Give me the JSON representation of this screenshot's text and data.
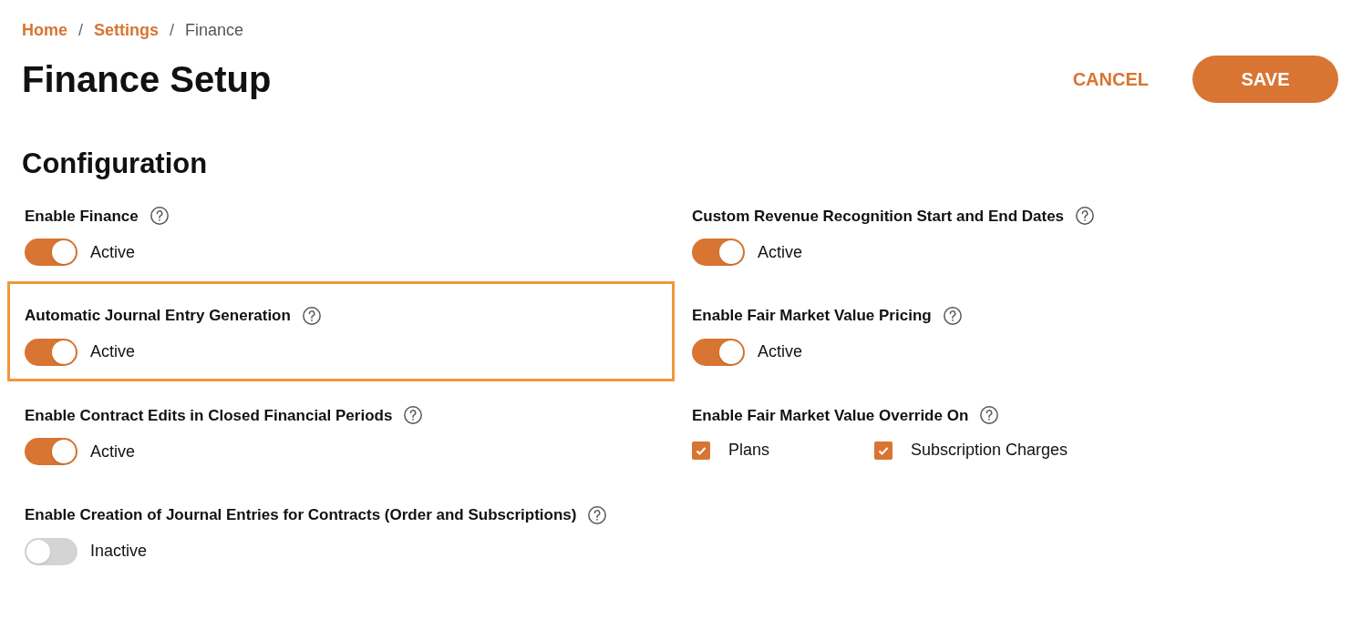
{
  "breadcrumb": [
    {
      "kind": "link",
      "label": "Home"
    },
    {
      "kind": "separator",
      "label": "/"
    },
    {
      "kind": "link",
      "label": "Settings"
    },
    {
      "kind": "separator",
      "label": "/"
    },
    {
      "kind": "current",
      "label": "Finance"
    }
  ],
  "title": "Finance Setup",
  "actions": {
    "cancel": "CANCEL",
    "save": "SAVE"
  },
  "section_title": "Configuration",
  "settings": [
    {
      "kind": "toggle",
      "label": "Enable Finance",
      "on": true,
      "status": "Active",
      "highlighted": false
    },
    {
      "kind": "toggle",
      "label": "Custom Revenue Recognition Start and End Dates",
      "on": true,
      "status": "Active",
      "highlighted": false
    },
    {
      "kind": "toggle",
      "label": "Automatic Journal Entry Generation",
      "on": true,
      "status": "Active",
      "highlighted": true
    },
    {
      "kind": "toggle",
      "label": "Enable Fair Market Value Pricing",
      "on": true,
      "status": "Active",
      "highlighted": false
    },
    {
      "kind": "toggle",
      "label": "Enable Contract Edits in Closed Financial Periods",
      "on": true,
      "status": "Active",
      "highlighted": false
    },
    {
      "kind": "checkboxes",
      "label": "Enable Fair Market Value Override On",
      "highlighted": false,
      "options": [
        {
          "label": "Plans",
          "checked": true
        },
        {
          "label": "Subscription Charges",
          "checked": true
        }
      ]
    },
    {
      "kind": "toggle",
      "label": "Enable Creation of Journal Entries for Contracts (Order and Subscriptions)",
      "on": false,
      "status": "Inactive",
      "highlighted": false
    }
  ]
}
